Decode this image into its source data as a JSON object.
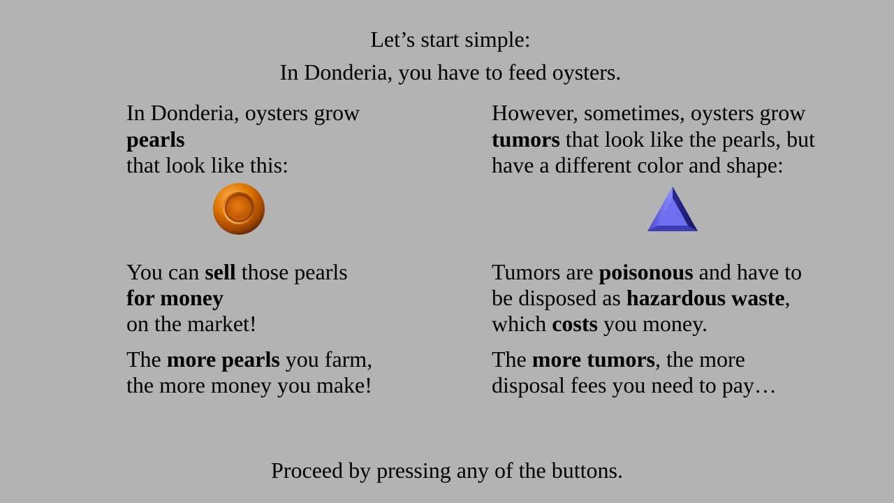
{
  "intro": {
    "line1": "Let’s start simple:",
    "line2": "In Donderia, you have to feed oysters."
  },
  "pearls": {
    "desc": {
      "l1": "In Donderia, oysters grow",
      "l2_bold": "pearls",
      "l3": "that look like this:"
    },
    "sell": {
      "l1_pre": "You can ",
      "l1_bold": "sell",
      "l1_post": " those pearls",
      "l2_bold": "for money",
      "l3": "on the market!"
    },
    "more": {
      "l1_pre": "The ",
      "l1_bold": "more pearls",
      "l1_post": " you farm,",
      "l2": "the more money you make!"
    }
  },
  "tumors": {
    "desc": {
      "l1": "However, sometimes, oysters grow",
      "l2_bold": "tumors",
      "l2_post": " that look like the pearls, but",
      "l3": "have a different color and shape:"
    },
    "poison": {
      "l1_pre": "Tumors are ",
      "l1_bold": "poisonous",
      "l1_post": " and have to",
      "l2_pre": "be disposed as ",
      "l2_bold": "hazardous waste",
      "l2_post": ",",
      "l3_pre": "which ",
      "l3_bold": "costs",
      "l3_post": " you money."
    },
    "more": {
      "l1_pre": "The ",
      "l1_bold": "more tumors",
      "l1_post": ", the more",
      "l2": "disposal fees you need to pay…"
    }
  },
  "footer": {
    "instruction": "Proceed by pressing any of the buttons."
  },
  "icons": {
    "pearl": "orange-circle-pearl-icon",
    "tumor": "blue-triangle-tumor-icon"
  },
  "colors": {
    "background": "#b3b3b3",
    "pearl": "#d86a00",
    "tumor": "#6a6af0"
  }
}
